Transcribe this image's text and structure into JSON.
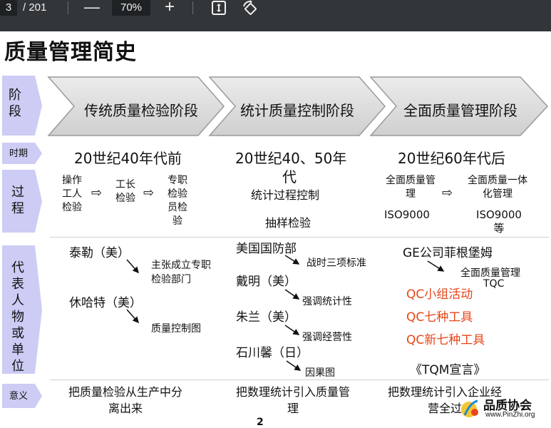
{
  "toolbar": {
    "page_current": "3",
    "page_total": "/ 201",
    "zoom_out": "—",
    "zoom_value": "70%",
    "zoom_in": "+",
    "icons": [
      "fit-page-icon",
      "rotate-icon"
    ]
  },
  "slide": {
    "title": "质量管理简史",
    "labels": {
      "stage": "阶段",
      "period": "时期",
      "process": "过程",
      "people": "代表人物或单位",
      "meaning": "意义"
    },
    "stages": [
      "传统质量检验阶段",
      "统计质量控制阶段",
      "全面质量管理阶段"
    ],
    "periods": [
      "20世纪40年代前",
      "20世纪40、50年",
      "代",
      "20世纪60年代后"
    ],
    "process": {
      "col1": [
        "操作工人检验",
        "工长检验",
        "专职检验员检验"
      ],
      "col2": [
        "统计过程控制",
        "抽样检验"
      ],
      "col3": [
        "全面质量管理",
        "全面质量一体化管理",
        "ISO9000",
        "ISO9000等"
      ],
      "arrow": "⇨"
    },
    "people": {
      "col1": [
        {
          "name": "泰勒（美）",
          "note": "主张成立专职检验部门"
        },
        {
          "name": "休哈特（美）",
          "note": "质量控制图"
        }
      ],
      "col2": [
        {
          "name": "美国国防部",
          "note": "战时三项标准"
        },
        {
          "name": "戴明（美）",
          "note": "强调统计性"
        },
        {
          "name": "朱兰（美）",
          "note": "强调经营性"
        },
        {
          "name": "石川馨（日）",
          "note": "因果图"
        }
      ],
      "col3": {
        "name": "GE公司菲根堡姆",
        "note1": "全面质量管理",
        "note2": "TQC",
        "red": [
          "QC小组活动",
          "QC七种工具",
          "QC新七种工具"
        ],
        "tqm": "《TQM宣言》"
      }
    },
    "meaning": [
      "把质量检验从生产中分离出来",
      "把数理统计引入质量管理",
      "把数理统计引入企业经营全过"
    ],
    "page_number_partial": "2",
    "colors": {
      "chevron": "#d9d9d9",
      "label_bg": "#ccccf5",
      "red_text": "#e8461a",
      "toolbar_bg": "#323639"
    }
  },
  "watermark": {
    "text": "品质协会",
    "url": "www.PinZhi.org"
  }
}
